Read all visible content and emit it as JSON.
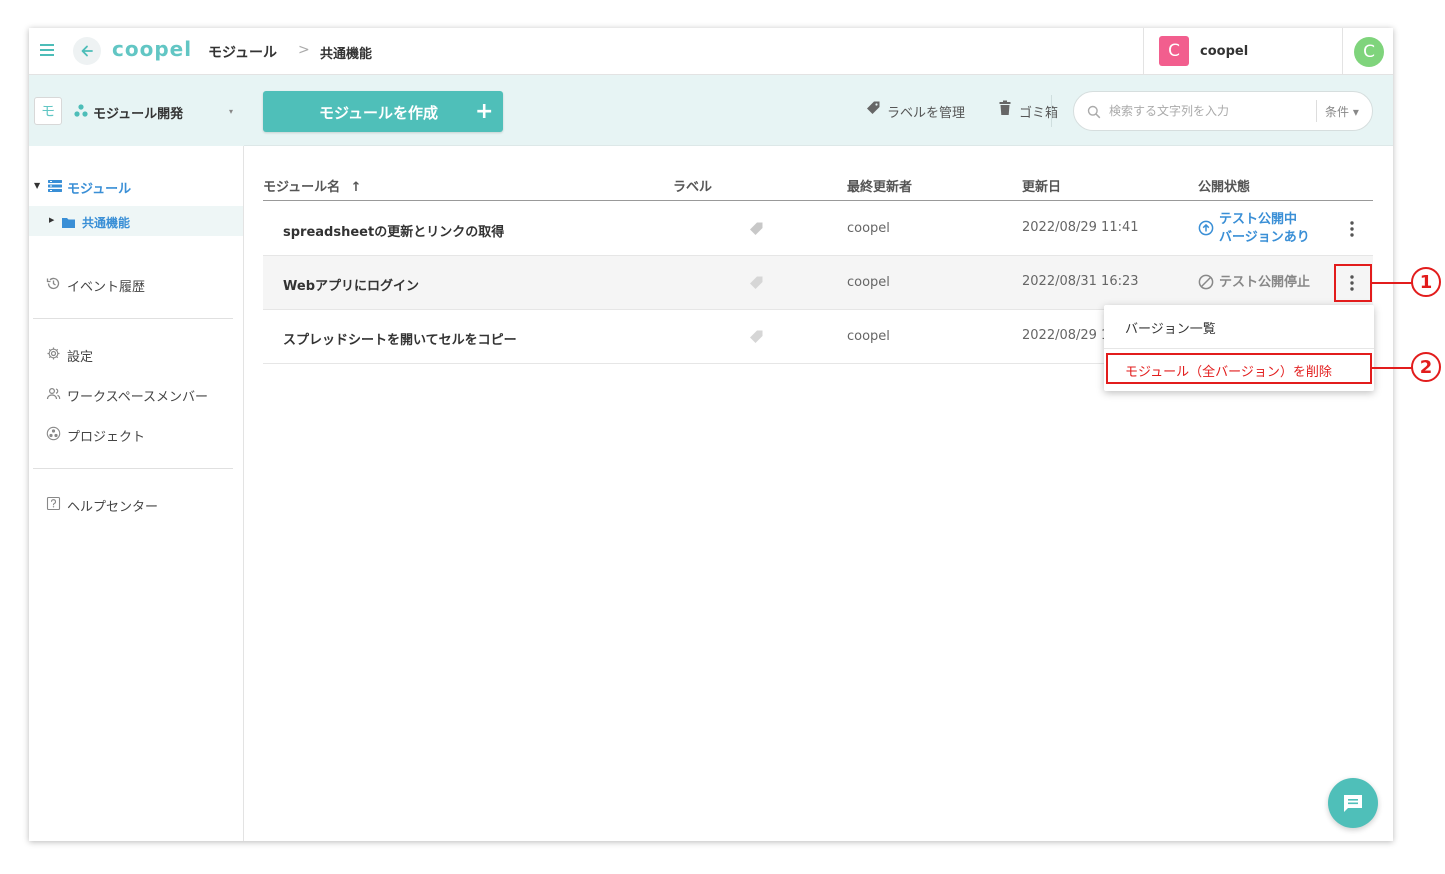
{
  "header": {
    "brand": "coopel",
    "breadcrumb": [
      "モジュール",
      "共通機能"
    ],
    "breadcrumb_sep": ">",
    "workspace": {
      "initial": "C",
      "name": "coopel",
      "color": "#f25e8e"
    },
    "user": {
      "initial": "C",
      "color": "#7fd47c"
    }
  },
  "sidebar": {
    "module_icon_char": "モ",
    "project_name": "モジュール開発",
    "dropdown_caret": "▾",
    "tree": {
      "root_label": "モジュール",
      "child_label": "共通機能"
    },
    "items": [
      {
        "label": "イベント履歴",
        "icon": "history-icon"
      },
      {
        "label": "設定",
        "icon": "gear-icon"
      },
      {
        "label": "ワークスペースメンバー",
        "icon": "members-icon"
      },
      {
        "label": "プロジェクト",
        "icon": "project-icon"
      },
      {
        "label": "ヘルプセンター",
        "icon": "help-icon"
      }
    ]
  },
  "toolbar": {
    "create_label": "モジュールを作成",
    "create_plus": "+",
    "manage_labels": "ラベルを管理",
    "trash": "ゴミ箱",
    "search_placeholder": "検索する文字列を入力",
    "condition": "条件 ▾"
  },
  "table": {
    "columns": {
      "name": "モジュール名",
      "sort_indicator": "↑",
      "label": "ラベル",
      "updater": "最終更新者",
      "updated": "更新日",
      "status": "公開状態"
    },
    "rows": [
      {
        "name": "spreadsheetの更新とリンクの取得",
        "updater": "coopel",
        "updated": "2022/08/29 11:41",
        "status_line1": "テスト公開中",
        "status_line2": "バージョンあり",
        "status_icon": "upload-circle-icon"
      },
      {
        "name": "Webアプリにログイン",
        "updater": "coopel",
        "updated": "2022/08/31 16:23",
        "status_line1": "テスト公開停止",
        "status_icon": "stop-circle-icon"
      },
      {
        "name": "スプレッドシートを開いてセルをコピー",
        "updater": "coopel",
        "updated": "2022/08/29 1"
      }
    ]
  },
  "context_menu": {
    "items": [
      {
        "label": "バージョン一覧"
      },
      {
        "label": "モジュール（全バージョン）を削除",
        "danger": true
      }
    ]
  },
  "annotations": [
    "1",
    "2"
  ],
  "colors": {
    "accent": "#4fbfb9",
    "link": "#3a8fd6",
    "toolbar_bg": "#e7f4f4",
    "annotation": "#e21c1c"
  }
}
